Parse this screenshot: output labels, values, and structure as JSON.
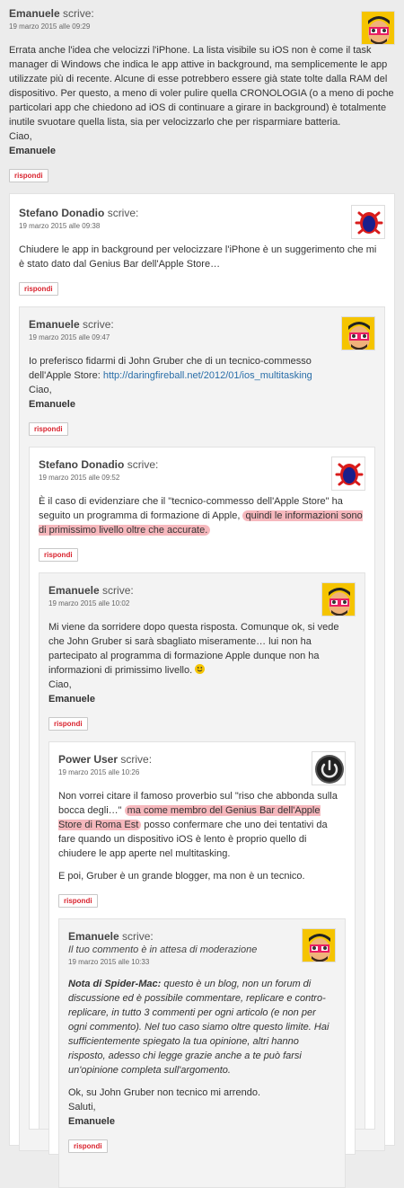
{
  "says_label": "scrive:",
  "reply_label": "rispondi",
  "comments": [
    {
      "author": "Emanuele",
      "date": "19 marzo 2015 alle 09:29",
      "text": "Errata anche l'idea che velocizzi l'iPhone. La lista visibile su iOS non è come il task manager di Windows che indica le app attive in background, ma semplicemente le app utilizzate più di recente. Alcune di esse potrebbero essere già state tolte dalla RAM del dispositivo. Per questo, a meno di voler pulire quella CRONOLOGIA (o a meno di poche particolari app che chiedono ad iOS di continuare a girare in background) è totalmente inutile svuotare quella lista, sia per velocizzarlo che per risparmiare batteria.",
      "closing": "Ciao,",
      "signature": "Emanuele",
      "avatar": "cartoon-man-glasses"
    },
    {
      "author": "Stefano Donadio",
      "date": "19 marzo 2015 alle 09:38",
      "text": "Chiudere le app in background per velocizzare l'iPhone è un suggerimento che mi è stato dato dal Genius Bar dell'Apple Store…",
      "avatar": "red-bug"
    },
    {
      "author": "Emanuele",
      "date": "19 marzo 2015 alle 09:47",
      "text": "Io preferisco fidarmi di John Gruber che di un tecnico-commesso dell'Apple Store: ",
      "link": "http://daringfireball.net/2012/01/ios_multitasking",
      "closing": "Ciao,",
      "signature": "Emanuele",
      "avatar": "cartoon-man-glasses"
    },
    {
      "author": "Stefano Donadio",
      "date": "19 marzo 2015 alle 09:52",
      "text": "È il caso di evidenziare che il \"tecnico-commesso dell'Apple Store\" ha seguito un programma di formazione di Apple, ",
      "highlight": "quindi le informazioni sono di primissimo livello oltre che accurate.",
      "avatar": "red-bug"
    },
    {
      "author": "Emanuele",
      "date": "19 marzo 2015 alle 10:02",
      "text": "Mi viene da sorridere dopo questa risposta. Comunque ok, si vede che John Gruber si sarà sbagliato miseramente… lui non ha partecipato al programma di formazione Apple dunque non ha informazioni di primissimo livello.",
      "closing": "Ciao,",
      "signature": "Emanuele",
      "avatar": "cartoon-man-glasses"
    },
    {
      "author": "Power User",
      "date": "19 marzo 2015 alle 10:26",
      "text_before": "Non vorrei citare il famoso proverbio sul \"riso che abbonda sulla bocca degli…\" ",
      "highlight": "ma come membro del Genius Bar dell'Apple Store di Roma Est",
      "text_after": " posso confermare che uno dei tentativi da fare quando un dispositivo iOS è lento è proprio quello di chiudere le app aperte nel multitasking.",
      "text2": "E poi, Gruber è un grande blogger, ma non è un tecnico.",
      "avatar": "power-button"
    },
    {
      "author": "Emanuele",
      "moderation": "Il tuo commento è in attesa di moderazione",
      "date": "19 marzo 2015 alle 10:33",
      "nota_label": "Nota di Spider-Mac:",
      "nota_text": " questo è un blog, non un forum di discussione ed è possibile commentare, replicare e contro-replicare, in tutto 3 commenti per ogni articolo (e non per ogni commento). Nel tuo caso siamo oltre questo limite. Hai sufficientemente spiegato la tua opinione, altri hanno risposto, adesso chi legge grazie anche a te può farsi un'opinione completa sull'argomento.",
      "text": "Ok, su John Gruber non tecnico mi arrendo.",
      "closing": "Saluti,",
      "signature": "Emanuele",
      "avatar": "cartoon-man-glasses"
    }
  ]
}
